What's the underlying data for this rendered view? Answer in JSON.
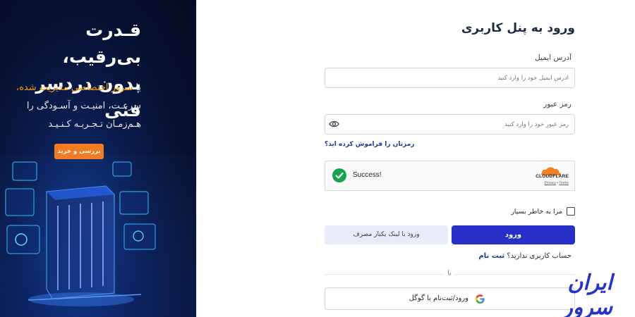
{
  "promo": {
    "title_line1": "قـدرت بی‌رقیب،",
    "title_line2": "بدون دردسر فنی",
    "line1_prefix": "با ",
    "line1_highlight": "سرور اختصاصی مدیریت شده،",
    "line2": "سرعـت، امنیـت و آسـودگی را",
    "line3": "هـم‌زمـان تـجـربـه کـنـیـد",
    "button_label": "بررسی و خرید",
    "accent_color": "#f47c20"
  },
  "form": {
    "title": "ورود به پنل کاربری",
    "email_label": "آدرس ایمیل",
    "email_placeholder": "آدرس ایمیل خود را وارد کنید",
    "email_value": "",
    "password_label": "رمز عبور",
    "password_placeholder": "رمز عبور خود را وارد کنید",
    "password_value": "",
    "forgot_link": "رمزتان را فراموش کرده اید؟",
    "captcha": {
      "status_text": "Success!",
      "provider": "CLOUDFLARE",
      "privacy": "Privacy",
      "separator": "•",
      "terms": "Terms"
    },
    "remember_label": "مرا به خاطر بسپار",
    "remember_checked": false,
    "login_button": "ورود",
    "magic_link_button": "ورود با لینک یکبار مصرف",
    "signup_prompt": "حساب کاربری ندارید؟",
    "signup_link": "ثبت نام",
    "or_text": "یا",
    "google_button": "ورود/ثبت‌نام با گوگل",
    "primary_color": "#2630c9"
  },
  "brand": {
    "logo_text": "ایران سرور"
  }
}
